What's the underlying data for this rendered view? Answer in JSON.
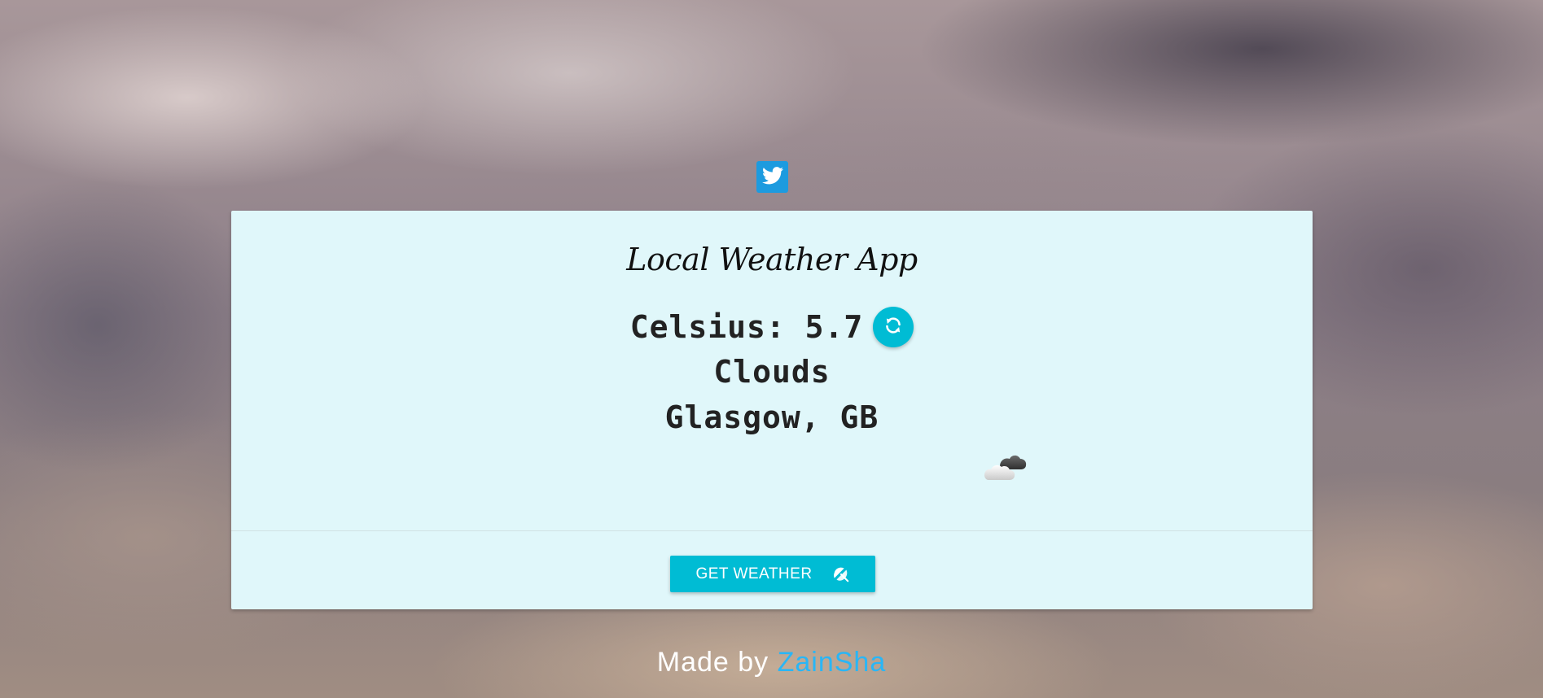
{
  "header": {
    "social_icon": "twitter-icon"
  },
  "card": {
    "title": "Local Weather App",
    "temperature_text": "Celsius: 5.7",
    "refresh_icon": "refresh-icon",
    "condition": "Clouds",
    "location": "Glasgow, GB",
    "weather_icon": "cloud-icon",
    "action": {
      "label": "GET WEATHER",
      "icon": "umbrella-beach-icon"
    }
  },
  "footer": {
    "prefix": "Made by ",
    "author": "ZainSha"
  },
  "colors": {
    "card_background": "#e0f7fa",
    "accent": "#00bcd4",
    "twitter_blue": "#1d9bdf",
    "author_link": "#29b6f6"
  }
}
